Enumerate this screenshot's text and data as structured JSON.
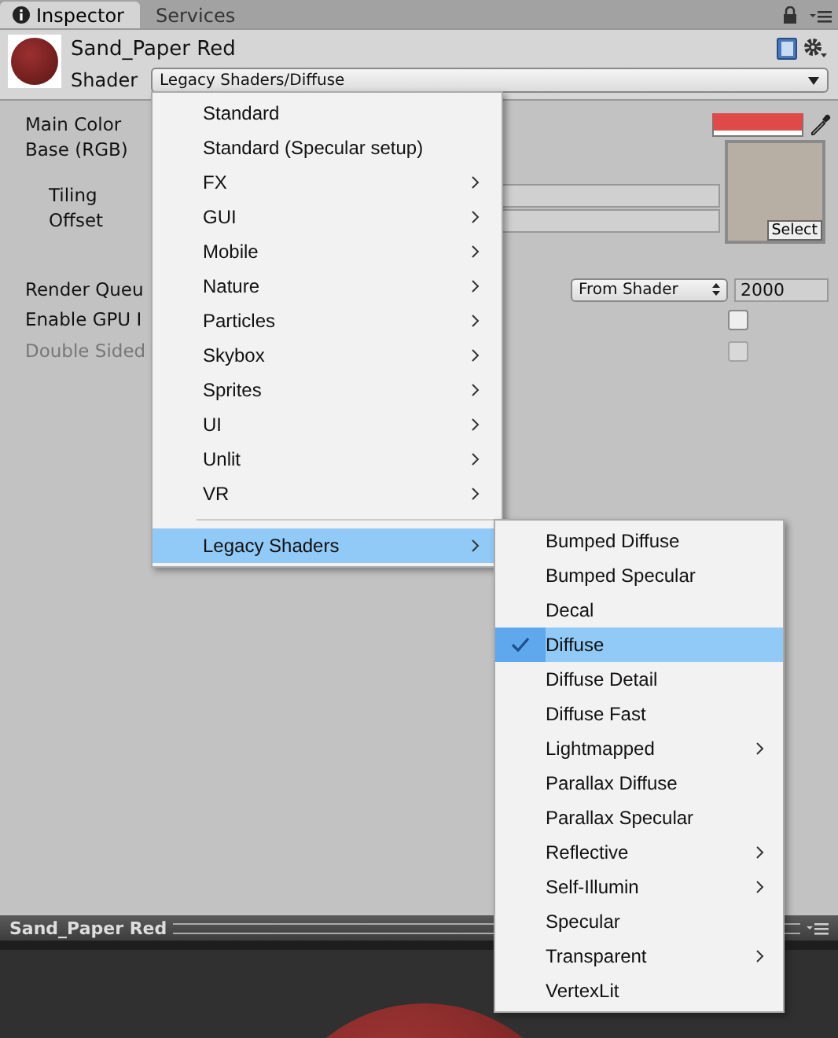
{
  "tabs": [
    {
      "label": "Inspector",
      "selected": true
    },
    {
      "label": "Services",
      "selected": false
    }
  ],
  "material": {
    "name": "Sand_Paper Red",
    "shader_label": "Shader",
    "shader_value": "Legacy Shaders/Diffuse"
  },
  "properties": [
    {
      "kind": "color",
      "label": "Main Color",
      "color": "#de4a4a"
    },
    {
      "kind": "texture",
      "label": "Base (RGB)",
      "button": "Select"
    },
    {
      "kind": "subfield",
      "label": "Tiling"
    },
    {
      "kind": "subfield",
      "label": "Offset"
    },
    {
      "kind": "queue",
      "label": "Render Queu",
      "option": "From Shader",
      "value": "2000"
    },
    {
      "kind": "checkbox",
      "label": "Enable GPU I",
      "checked": false,
      "disabled": false
    },
    {
      "kind": "checkbox",
      "label": "Double Sided",
      "checked": false,
      "disabled": true
    }
  ],
  "shader_menu": [
    {
      "kind": "item",
      "label": "Standard",
      "submenu": false,
      "selected": false
    },
    {
      "kind": "item",
      "label": "Standard (Specular setup)",
      "submenu": false,
      "selected": false
    },
    {
      "kind": "item",
      "label": "FX",
      "submenu": true,
      "selected": false
    },
    {
      "kind": "item",
      "label": "GUI",
      "submenu": true,
      "selected": false
    },
    {
      "kind": "item",
      "label": "Mobile",
      "submenu": true,
      "selected": false
    },
    {
      "kind": "item",
      "label": "Nature",
      "submenu": true,
      "selected": false
    },
    {
      "kind": "item",
      "label": "Particles",
      "submenu": true,
      "selected": false
    },
    {
      "kind": "item",
      "label": "Skybox",
      "submenu": true,
      "selected": false
    },
    {
      "kind": "item",
      "label": "Sprites",
      "submenu": true,
      "selected": false
    },
    {
      "kind": "item",
      "label": "UI",
      "submenu": true,
      "selected": false
    },
    {
      "kind": "item",
      "label": "Unlit",
      "submenu": true,
      "selected": false
    },
    {
      "kind": "item",
      "label": "VR",
      "submenu": true,
      "selected": false
    },
    {
      "kind": "separator"
    },
    {
      "kind": "item",
      "label": "Legacy Shaders",
      "submenu": true,
      "selected": true
    }
  ],
  "legacy_submenu": [
    {
      "label": "Bumped Diffuse",
      "submenu": false,
      "selected": false,
      "checked": false
    },
    {
      "label": "Bumped Specular",
      "submenu": false,
      "selected": false,
      "checked": false
    },
    {
      "label": "Decal",
      "submenu": false,
      "selected": false,
      "checked": false
    },
    {
      "label": "Diffuse",
      "submenu": false,
      "selected": true,
      "checked": true
    },
    {
      "label": "Diffuse Detail",
      "submenu": false,
      "selected": false,
      "checked": false
    },
    {
      "label": "Diffuse Fast",
      "submenu": false,
      "selected": false,
      "checked": false
    },
    {
      "label": "Lightmapped",
      "submenu": true,
      "selected": false,
      "checked": false
    },
    {
      "label": "Parallax Diffuse",
      "submenu": false,
      "selected": false,
      "checked": false
    },
    {
      "label": "Parallax Specular",
      "submenu": false,
      "selected": false,
      "checked": false
    },
    {
      "label": "Reflective",
      "submenu": true,
      "selected": false,
      "checked": false
    },
    {
      "label": "Self-Illumin",
      "submenu": true,
      "selected": false,
      "checked": false
    },
    {
      "label": "Specular",
      "submenu": false,
      "selected": false,
      "checked": false
    },
    {
      "label": "Transparent",
      "submenu": true,
      "selected": false,
      "checked": false
    },
    {
      "label": "VertexLit",
      "submenu": false,
      "selected": false,
      "checked": false
    }
  ],
  "preview": {
    "title": "Sand_Paper Red"
  }
}
